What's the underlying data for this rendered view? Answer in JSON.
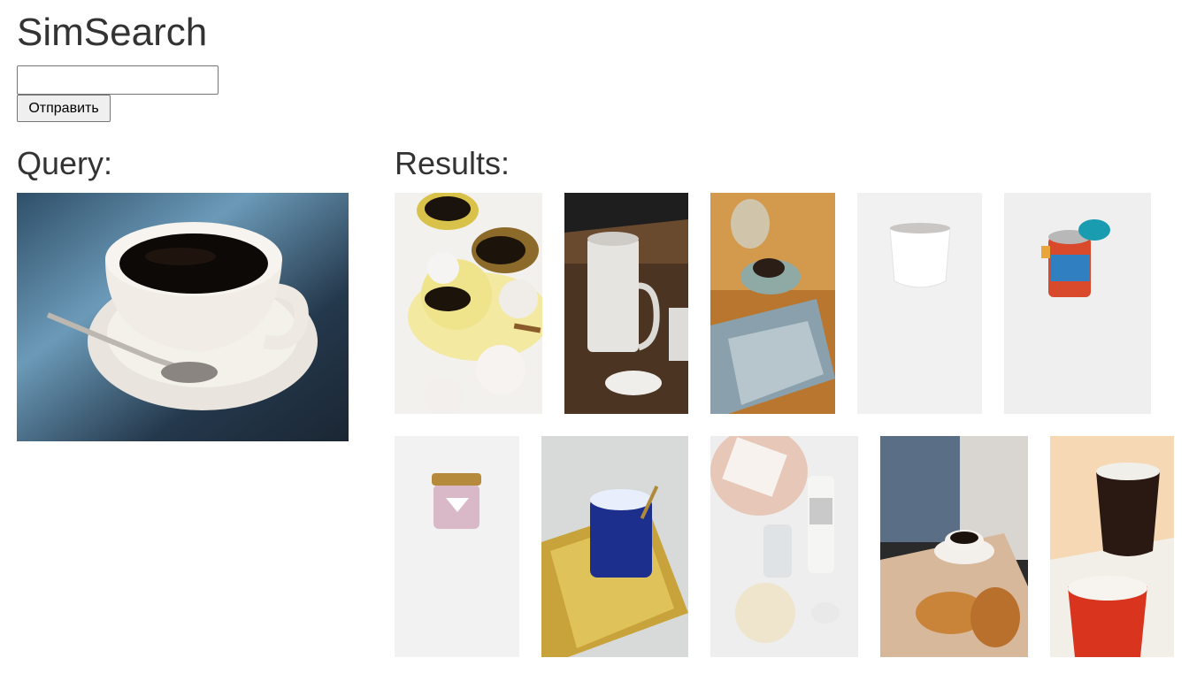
{
  "app": {
    "title": "SimSearch"
  },
  "search": {
    "value": "",
    "placeholder": "",
    "submit_label": "Отправить"
  },
  "query": {
    "heading": "Query:",
    "image": "coffee-cup-on-saucer-with-spoon"
  },
  "results": {
    "heading": "Results:",
    "items": [
      {
        "name": "yellow-coffee-cups-with-meringues"
      },
      {
        "name": "white-pour-over-coffee-pot"
      },
      {
        "name": "espresso-cup-on-table-with-magazine"
      },
      {
        "name": "white-ceramic-cup"
      },
      {
        "name": "colorful-food-thermos-jar"
      },
      {
        "name": "pink-scented-candle-jar"
      },
      {
        "name": "blue-jar-on-gold-tray"
      },
      {
        "name": "cosmetic-bottles-and-sponge"
      },
      {
        "name": "coffee-with-croissants"
      },
      {
        "name": "enamel-cups-black-and-red"
      }
    ]
  }
}
